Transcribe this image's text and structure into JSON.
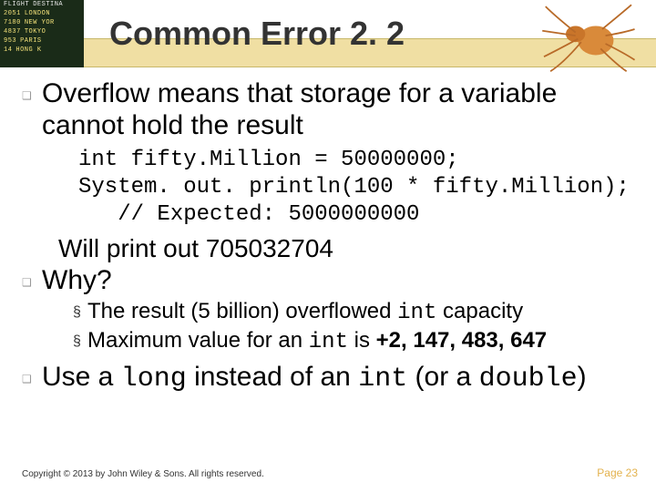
{
  "board": [
    [
      "FLIGHT",
      "DESTINA"
    ],
    [
      "2051",
      "LONDON"
    ],
    [
      "7180",
      "NEW YOR"
    ],
    [
      "4837",
      "TOKYO"
    ],
    [
      "953",
      "PARIS"
    ],
    [
      "14",
      "HONG K"
    ]
  ],
  "title": "Common Error 2. 2",
  "bullets": {
    "b1": "Overflow means that storage for a variable cannot hold the result",
    "code1": "int fifty.Million = 50000000;",
    "code2": "System. out. println(100 * fifty.Million);",
    "code3": "   // Expected: 5000000000",
    "after_code": "Will print out 705032704",
    "b2": "Why?",
    "sub1_a": "The result (5 billion) overflowed ",
    "sub1_b": "int",
    "sub1_c": " capacity",
    "sub2_a": "Maximum value for an ",
    "sub2_b": "int",
    "sub2_c": " is ",
    "sub2_d": "+2, 147, 483, 647",
    "b3_a": "Use a ",
    "b3_b": "long",
    "b3_c": " instead of an ",
    "b3_d": "int",
    "b3_e": " (or a ",
    "b3_f": "double",
    "b3_g": ")"
  },
  "footer": "Copyright © 2013 by John Wiley & Sons. All rights reserved.",
  "page": "Page 23"
}
